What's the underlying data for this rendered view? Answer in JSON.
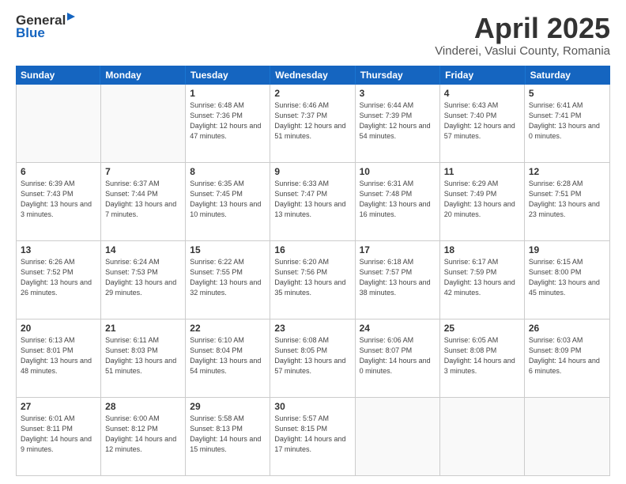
{
  "logo": {
    "general": "General",
    "blue": "Blue"
  },
  "title": "April 2025",
  "location": "Vinderei, Vaslui County, Romania",
  "header_days": [
    "Sunday",
    "Monday",
    "Tuesday",
    "Wednesday",
    "Thursday",
    "Friday",
    "Saturday"
  ],
  "weeks": [
    [
      {
        "day": "",
        "detail": ""
      },
      {
        "day": "",
        "detail": ""
      },
      {
        "day": "1",
        "detail": "Sunrise: 6:48 AM\nSunset: 7:36 PM\nDaylight: 12 hours\nand 47 minutes."
      },
      {
        "day": "2",
        "detail": "Sunrise: 6:46 AM\nSunset: 7:37 PM\nDaylight: 12 hours\nand 51 minutes."
      },
      {
        "day": "3",
        "detail": "Sunrise: 6:44 AM\nSunset: 7:39 PM\nDaylight: 12 hours\nand 54 minutes."
      },
      {
        "day": "4",
        "detail": "Sunrise: 6:43 AM\nSunset: 7:40 PM\nDaylight: 12 hours\nand 57 minutes."
      },
      {
        "day": "5",
        "detail": "Sunrise: 6:41 AM\nSunset: 7:41 PM\nDaylight: 13 hours\nand 0 minutes."
      }
    ],
    [
      {
        "day": "6",
        "detail": "Sunrise: 6:39 AM\nSunset: 7:43 PM\nDaylight: 13 hours\nand 3 minutes."
      },
      {
        "day": "7",
        "detail": "Sunrise: 6:37 AM\nSunset: 7:44 PM\nDaylight: 13 hours\nand 7 minutes."
      },
      {
        "day": "8",
        "detail": "Sunrise: 6:35 AM\nSunset: 7:45 PM\nDaylight: 13 hours\nand 10 minutes."
      },
      {
        "day": "9",
        "detail": "Sunrise: 6:33 AM\nSunset: 7:47 PM\nDaylight: 13 hours\nand 13 minutes."
      },
      {
        "day": "10",
        "detail": "Sunrise: 6:31 AM\nSunset: 7:48 PM\nDaylight: 13 hours\nand 16 minutes."
      },
      {
        "day": "11",
        "detail": "Sunrise: 6:29 AM\nSunset: 7:49 PM\nDaylight: 13 hours\nand 20 minutes."
      },
      {
        "day": "12",
        "detail": "Sunrise: 6:28 AM\nSunset: 7:51 PM\nDaylight: 13 hours\nand 23 minutes."
      }
    ],
    [
      {
        "day": "13",
        "detail": "Sunrise: 6:26 AM\nSunset: 7:52 PM\nDaylight: 13 hours\nand 26 minutes."
      },
      {
        "day": "14",
        "detail": "Sunrise: 6:24 AM\nSunset: 7:53 PM\nDaylight: 13 hours\nand 29 minutes."
      },
      {
        "day": "15",
        "detail": "Sunrise: 6:22 AM\nSunset: 7:55 PM\nDaylight: 13 hours\nand 32 minutes."
      },
      {
        "day": "16",
        "detail": "Sunrise: 6:20 AM\nSunset: 7:56 PM\nDaylight: 13 hours\nand 35 minutes."
      },
      {
        "day": "17",
        "detail": "Sunrise: 6:18 AM\nSunset: 7:57 PM\nDaylight: 13 hours\nand 38 minutes."
      },
      {
        "day": "18",
        "detail": "Sunrise: 6:17 AM\nSunset: 7:59 PM\nDaylight: 13 hours\nand 42 minutes."
      },
      {
        "day": "19",
        "detail": "Sunrise: 6:15 AM\nSunset: 8:00 PM\nDaylight: 13 hours\nand 45 minutes."
      }
    ],
    [
      {
        "day": "20",
        "detail": "Sunrise: 6:13 AM\nSunset: 8:01 PM\nDaylight: 13 hours\nand 48 minutes."
      },
      {
        "day": "21",
        "detail": "Sunrise: 6:11 AM\nSunset: 8:03 PM\nDaylight: 13 hours\nand 51 minutes."
      },
      {
        "day": "22",
        "detail": "Sunrise: 6:10 AM\nSunset: 8:04 PM\nDaylight: 13 hours\nand 54 minutes."
      },
      {
        "day": "23",
        "detail": "Sunrise: 6:08 AM\nSunset: 8:05 PM\nDaylight: 13 hours\nand 57 minutes."
      },
      {
        "day": "24",
        "detail": "Sunrise: 6:06 AM\nSunset: 8:07 PM\nDaylight: 14 hours\nand 0 minutes."
      },
      {
        "day": "25",
        "detail": "Sunrise: 6:05 AM\nSunset: 8:08 PM\nDaylight: 14 hours\nand 3 minutes."
      },
      {
        "day": "26",
        "detail": "Sunrise: 6:03 AM\nSunset: 8:09 PM\nDaylight: 14 hours\nand 6 minutes."
      }
    ],
    [
      {
        "day": "27",
        "detail": "Sunrise: 6:01 AM\nSunset: 8:11 PM\nDaylight: 14 hours\nand 9 minutes."
      },
      {
        "day": "28",
        "detail": "Sunrise: 6:00 AM\nSunset: 8:12 PM\nDaylight: 14 hours\nand 12 minutes."
      },
      {
        "day": "29",
        "detail": "Sunrise: 5:58 AM\nSunset: 8:13 PM\nDaylight: 14 hours\nand 15 minutes."
      },
      {
        "day": "30",
        "detail": "Sunrise: 5:57 AM\nSunset: 8:15 PM\nDaylight: 14 hours\nand 17 minutes."
      },
      {
        "day": "",
        "detail": ""
      },
      {
        "day": "",
        "detail": ""
      },
      {
        "day": "",
        "detail": ""
      }
    ]
  ]
}
